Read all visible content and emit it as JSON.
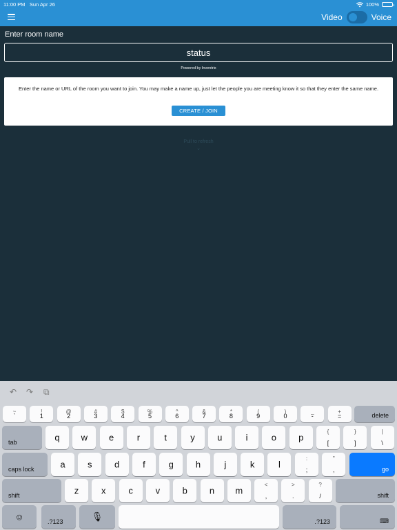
{
  "status_bar": {
    "time": "11:00 PM",
    "date": "Sun Apr 26",
    "battery": "100%"
  },
  "header": {
    "video_label": "Video",
    "voice_label": "Voice"
  },
  "room": {
    "label": "Enter room name",
    "value": "status",
    "powered_by": "Powered by Inventrix"
  },
  "card": {
    "instructions": "Enter the name or URL of the room you want to join. You may make a name up, just let the people you are meeting know it so that they enter the same name.",
    "button_label": "CREATE / JOIN"
  },
  "pull_to_refresh": {
    "text": "Pull to refresh",
    "arrow": "⌄"
  },
  "keyboard": {
    "toolbar": {
      "undo": "↶",
      "redo": "↷",
      "paste": "⧉"
    },
    "number_row": [
      {
        "top": "~",
        "bot": "`"
      },
      {
        "top": "!",
        "bot": "1"
      },
      {
        "top": "@",
        "bot": "2"
      },
      {
        "top": "#",
        "bot": "3"
      },
      {
        "top": "$",
        "bot": "4"
      },
      {
        "top": "%",
        "bot": "5"
      },
      {
        "top": "^",
        "bot": "6"
      },
      {
        "top": "&",
        "bot": "7"
      },
      {
        "top": "*",
        "bot": "8"
      },
      {
        "top": "(",
        "bot": "9"
      },
      {
        "top": ")",
        "bot": "0"
      },
      {
        "top": "_",
        "bot": "-"
      },
      {
        "top": "+",
        "bot": "="
      }
    ],
    "delete_label": "delete",
    "tab_label": "tab",
    "row_q": [
      "q",
      "w",
      "e",
      "r",
      "t",
      "y",
      "u",
      "i",
      "o",
      "p"
    ],
    "row_q_extra": [
      {
        "top": "{",
        "bot": "["
      },
      {
        "top": "}",
        "bot": "]"
      },
      {
        "top": "|",
        "bot": "\\"
      }
    ],
    "caps_label": "caps lock",
    "row_a": [
      "a",
      "s",
      "d",
      "f",
      "g",
      "h",
      "j",
      "k",
      "l"
    ],
    "row_a_extra": [
      {
        "top": ":",
        "bot": ";"
      },
      {
        "top": "\"",
        "bot": ","
      }
    ],
    "go_label": "go",
    "shift_label": "shift",
    "row_z": [
      "z",
      "x",
      "c",
      "v",
      "b",
      "n",
      "m"
    ],
    "row_z_extra": [
      {
        "top": "<",
        "bot": ","
      },
      {
        "top": ">",
        "bot": "."
      },
      {
        "top": "?",
        "bot": "/"
      }
    ],
    "emoji": "☺",
    "numbers_label": ".?123",
    "mic": "🎙",
    "hide": "⌨"
  }
}
